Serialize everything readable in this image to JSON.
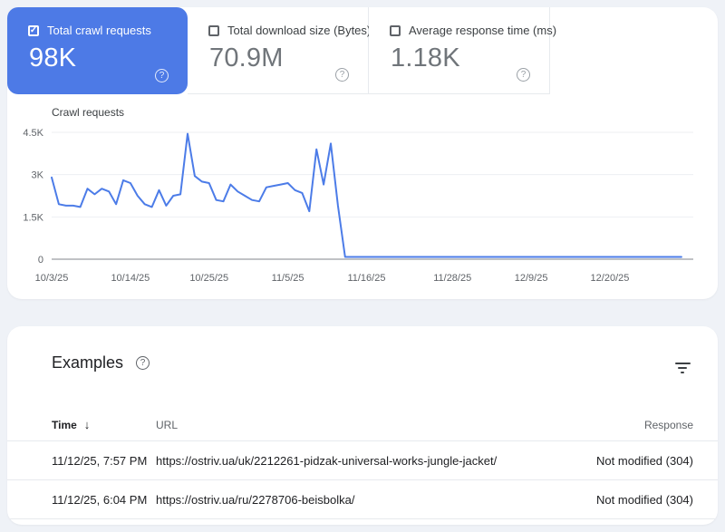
{
  "colors": {
    "accent_blue": "#4d7ae6",
    "chart_line": "#4c7ce8",
    "page_background": "#eff2f7",
    "zero_axis": "#80868b",
    "gridline": "#edeff2"
  },
  "icons": {
    "help": "?",
    "check": "✓",
    "sort_desc": "↓",
    "filter": "filter-funnel"
  },
  "metrics": [
    {
      "label": "Total crawl requests",
      "value": "98K",
      "selected": true,
      "checked": true
    },
    {
      "label": "Total download size (Bytes)",
      "value": "70.9M",
      "selected": false,
      "checked": false
    },
    {
      "label": "Average response time (ms)",
      "value": "1.18K",
      "selected": false,
      "checked": false
    }
  ],
  "chart_data": {
    "type": "line",
    "title": "Crawl requests",
    "series_name": "Total crawl requests",
    "series_color": "#4c7ce8",
    "ylim": [
      0,
      4500
    ],
    "grid": true,
    "legend": false,
    "y_ticks": [
      {
        "value": 0,
        "label": "0"
      },
      {
        "value": 1500,
        "label": "1.5K"
      },
      {
        "value": 3000,
        "label": "3K"
      },
      {
        "value": 4500,
        "label": "4.5K"
      }
    ],
    "x_ticks": [
      {
        "index": 0,
        "label": "10/3/25"
      },
      {
        "index": 11,
        "label": "10/14/25"
      },
      {
        "index": 22,
        "label": "10/25/25"
      },
      {
        "index": 33,
        "label": "11/5/25"
      },
      {
        "index": 44,
        "label": "11/16/25"
      },
      {
        "index": 56,
        "label": "11/28/25"
      },
      {
        "index": 67,
        "label": "12/9/25"
      },
      {
        "index": 78,
        "label": "12/20/25"
      }
    ],
    "x_start_date": "10/3/25",
    "x_end_date": "12/30/25",
    "values": [
      2900,
      1950,
      1900,
      1900,
      1850,
      2500,
      2300,
      2500,
      2400,
      1950,
      2800,
      2700,
      2250,
      1950,
      1850,
      2450,
      1900,
      2250,
      2300,
      4450,
      2950,
      2750,
      2700,
      2100,
      2050,
      2650,
      2400,
      2250,
      2100,
      2050,
      2550,
      2600,
      2650,
      2700,
      2450,
      2350,
      1700,
      3900,
      2650,
      4100,
      1900,
      80,
      80,
      80,
      80,
      80,
      80,
      80,
      80,
      80,
      80,
      80,
      80,
      80,
      80,
      80,
      80,
      80,
      80,
      80,
      80,
      80,
      80,
      80,
      80,
      80,
      80,
      80,
      80,
      80,
      80,
      80,
      80,
      80,
      80,
      80,
      80,
      80,
      80,
      80,
      80,
      80,
      80,
      80,
      80,
      80,
      80,
      80,
      80
    ]
  },
  "examples": {
    "title": "Examples",
    "columns": {
      "time": "Time",
      "url": "URL",
      "response": "Response"
    },
    "rows": [
      {
        "time": "11/12/25, 7:57 PM",
        "url": "https://ostriv.ua/uk/2212261-pidzak-universal-works-jungle-jacket/",
        "response": "Not modified (304)"
      },
      {
        "time": "11/12/25, 6:04 PM",
        "url": "https://ostriv.ua/ru/2278706-beisbolka/",
        "response": "Not modified (304)"
      }
    ]
  }
}
